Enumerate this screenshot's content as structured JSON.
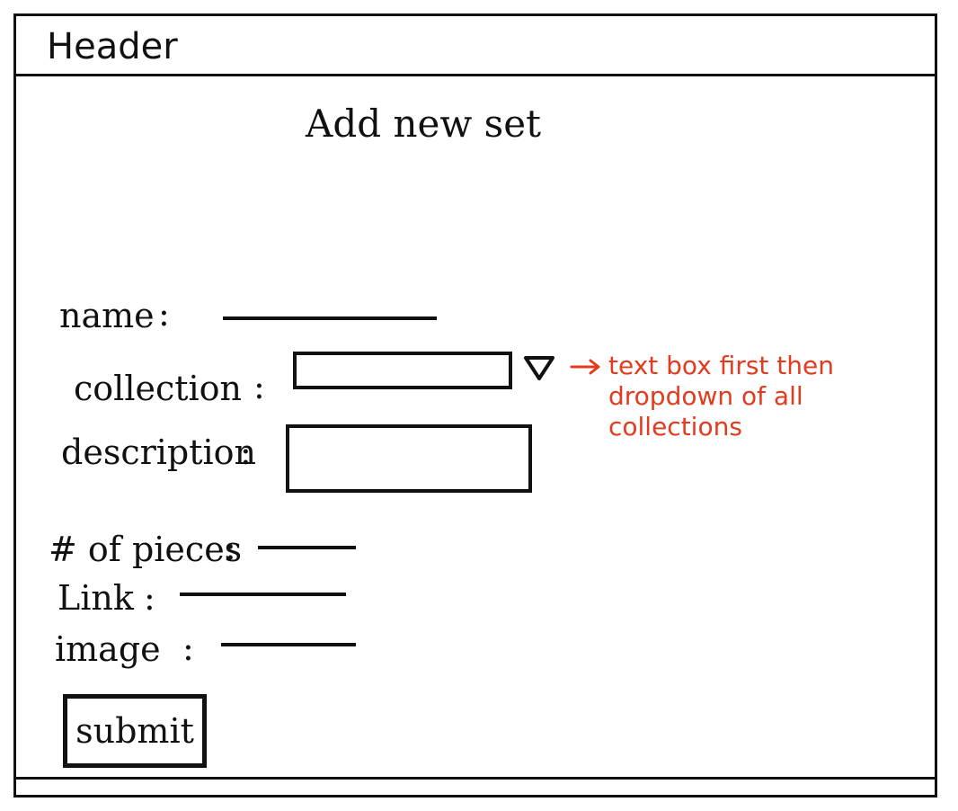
{
  "header": {
    "title": "Header"
  },
  "main": {
    "title": "Add new set",
    "form": {
      "name_label": "name",
      "name_colon": ":",
      "collection_label": "collection",
      "collection_colon": ":",
      "collection_icon": "dropdown-triangle-icon",
      "description_label": "description",
      "description_colon": ":",
      "pieces_label": "# of pieces",
      "pieces_colon": ":",
      "link_label": "Link",
      "link_colon": ":",
      "image_label": "image",
      "image_colon": ":",
      "submit_label": "submit"
    },
    "annotation": {
      "text": "text box first then dropdown of all collections",
      "color": "#e23b1f"
    }
  }
}
